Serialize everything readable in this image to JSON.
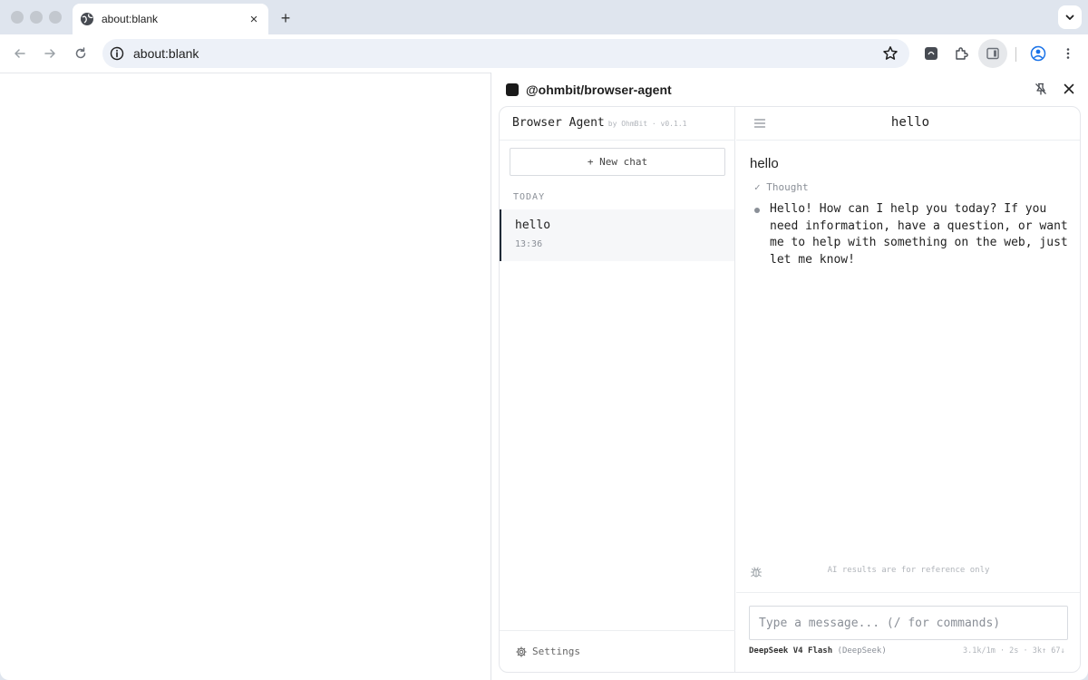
{
  "browser": {
    "tab_title": "about:blank",
    "url": "about:blank"
  },
  "side_panel": {
    "title": "@ohmbit/browser-agent"
  },
  "app": {
    "brand_name": "Browser Agent",
    "brand_by": "by OhmBit · v0.1.1",
    "new_chat_label": "+ New chat",
    "section_label": "TODAY",
    "conversations": [
      {
        "title": "hello",
        "time": "13:36"
      }
    ],
    "settings_label": "Settings",
    "chat_title": "hello",
    "messages": {
      "user": "hello",
      "thought_label": "✓ Thought",
      "assistant": "Hello! How can I help you today? If you need information, have a question, or want me to help with something on the web, just let me know!"
    },
    "disclaimer": "AI results are for reference only",
    "input_placeholder": "Type a message... (/ for commands)",
    "model_name": "DeepSeek V4 Flash",
    "model_provider": "(DeepSeek)",
    "stats": "3.1k/1m · 2s · 3k↑ 67↓"
  },
  "colors": {
    "chrome_bg": "#dfe5ee",
    "omnibox_bg": "#edf1f8",
    "active_conv_border": "#1f2937"
  }
}
